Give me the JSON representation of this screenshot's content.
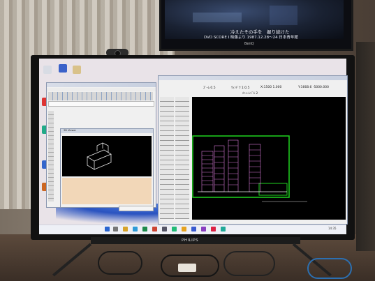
{
  "second_monitor": {
    "subtitle_line1": "冷えたその手を　握り続けた",
    "subtitle_line2": "DVD SCORE I 映像より 1987.12.28～24 日本青年館",
    "brand": "BenQ"
  },
  "main_monitor": {
    "brand": "PHILIPS",
    "cad_window": {
      "status_fields": [
        "ｽﾞｰﾑ  0.5   ",
        "ｳｨﾝﾄﾞｳ 1:0.5",
        "X:1500 1.000",
        "Y:1668.6 -5000.000"
      ],
      "tool_label": "ﾒﾆｭｰﾚﾍﾞﾙ 2"
    },
    "viewer_window": {
      "title": "3D Viewer"
    },
    "taskbar_time": "14:35"
  },
  "colors": {
    "cad_background": "#000000",
    "drawing_frame": "#1fd51f",
    "building_lines": "#d87ad8",
    "screen_bg": "#e9e3e8"
  }
}
